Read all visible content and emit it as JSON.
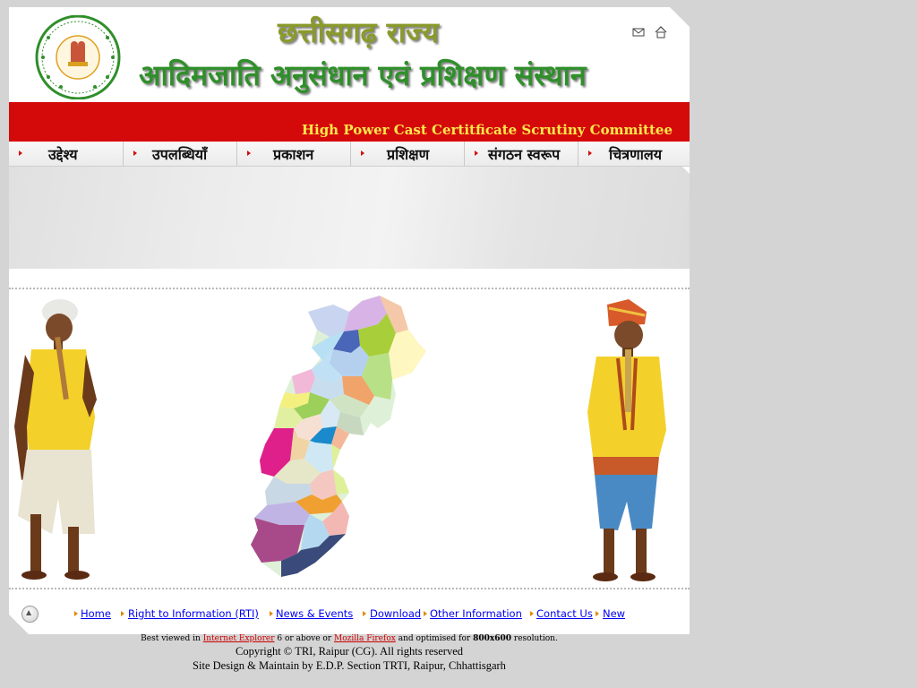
{
  "header": {
    "state_title": "छत्तीसगढ़ राज्य",
    "institute_title": "आदिमजाति अनुसंधान एवं प्रशिक्षण संस्थान",
    "emblem_text": "छत्तीसगढ़ शासन",
    "mail_icon": "mail-icon",
    "home_icon": "home-icon"
  },
  "banner": {
    "text": "High Power Cast Certitficate Scrutiny Committee",
    "bg_color": "#d40a0a",
    "text_color": "#ffe84a"
  },
  "nav": {
    "items": [
      {
        "label": "उद्देश्य"
      },
      {
        "label": "उपलब्धियाँ"
      },
      {
        "label": "प्रकाशन"
      },
      {
        "label": "प्रशिक्षण"
      },
      {
        "label": "संगठन स्वरूप"
      },
      {
        "label": "चित्रणालय"
      }
    ]
  },
  "footer": {
    "links": [
      {
        "label": "Home"
      },
      {
        "label": "Right to Information (RTI)"
      },
      {
        "label": "News & Events"
      },
      {
        "label": "Download"
      },
      {
        "label": "Other Information"
      },
      {
        "label": "Contact Us "
      },
      {
        "label": "New"
      }
    ],
    "best_viewed_prefix": "Best viewed in",
    "ie_link": "Internet Explorer",
    "best_viewed_mid": "6 or above or",
    "firefox_link": "Mozilla Firefox",
    "best_viewed_mid2": "and optimised for",
    "resolution": "800x600",
    "best_viewed_suffix": "resolution.",
    "copyright": "Copyright ©  TRI, Raipur (CG). All rights reserved",
    "maintain": "Site Design & Maintain  by E.D.P. Section TRTI, Raipur, Chhattisgarh"
  }
}
